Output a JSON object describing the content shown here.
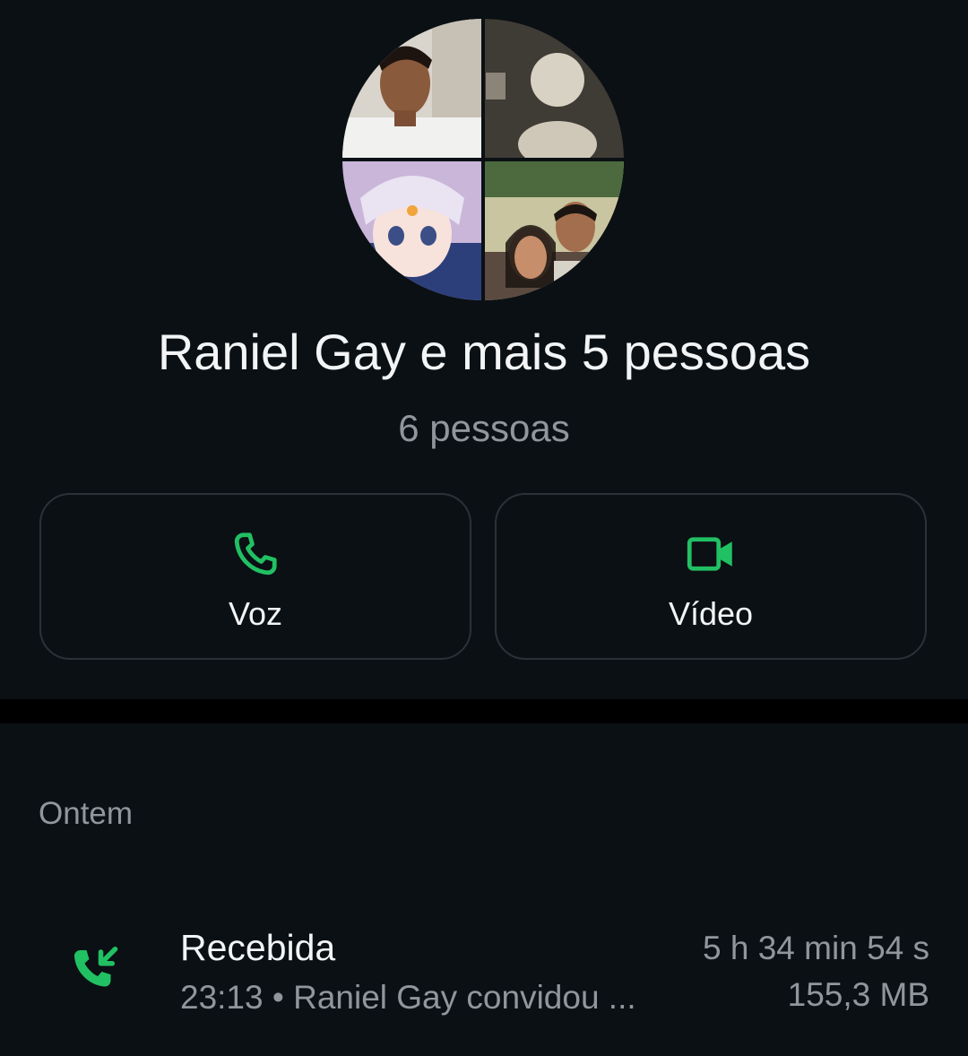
{
  "header": {
    "title": "Raniel Gay e mais 5 pessoas",
    "subtitle": "6 pessoas",
    "avatar_icon": "group-avatar-icon"
  },
  "actions": {
    "voice": {
      "label": "Voz",
      "icon": "phone-icon"
    },
    "video": {
      "label": "Vídeo",
      "icon": "video-camera-icon"
    }
  },
  "colors": {
    "accent": "#21c063",
    "background": "#0b1014",
    "secondary_text": "#8f979d"
  },
  "calls": {
    "section_label": "Ontem",
    "items": [
      {
        "type": "Recebida",
        "detail": "23:13 • Raniel Gay convidou ...",
        "duration": "5 h 34 min 54 s",
        "size": "155,3 MB",
        "icon": "incoming-call-icon"
      }
    ]
  }
}
